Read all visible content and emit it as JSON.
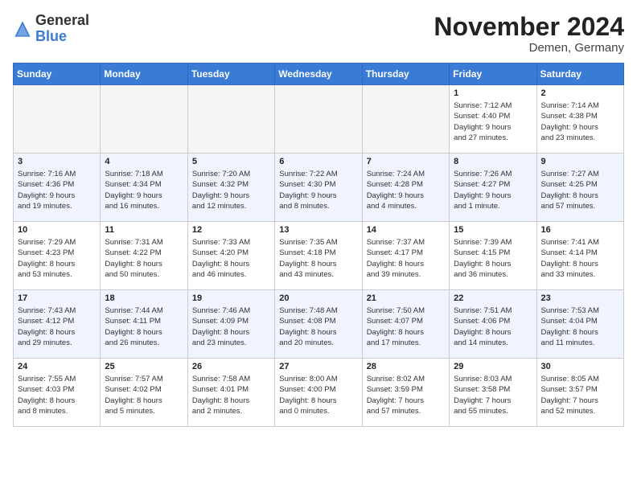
{
  "header": {
    "logo_general": "General",
    "logo_blue": "Blue",
    "month_title": "November 2024",
    "location": "Demen, Germany"
  },
  "weekdays": [
    "Sunday",
    "Monday",
    "Tuesday",
    "Wednesday",
    "Thursday",
    "Friday",
    "Saturday"
  ],
  "weeks": [
    [
      {
        "day": "",
        "info": ""
      },
      {
        "day": "",
        "info": ""
      },
      {
        "day": "",
        "info": ""
      },
      {
        "day": "",
        "info": ""
      },
      {
        "day": "",
        "info": ""
      },
      {
        "day": "1",
        "info": "Sunrise: 7:12 AM\nSunset: 4:40 PM\nDaylight: 9 hours\nand 27 minutes."
      },
      {
        "day": "2",
        "info": "Sunrise: 7:14 AM\nSunset: 4:38 PM\nDaylight: 9 hours\nand 23 minutes."
      }
    ],
    [
      {
        "day": "3",
        "info": "Sunrise: 7:16 AM\nSunset: 4:36 PM\nDaylight: 9 hours\nand 19 minutes."
      },
      {
        "day": "4",
        "info": "Sunrise: 7:18 AM\nSunset: 4:34 PM\nDaylight: 9 hours\nand 16 minutes."
      },
      {
        "day": "5",
        "info": "Sunrise: 7:20 AM\nSunset: 4:32 PM\nDaylight: 9 hours\nand 12 minutes."
      },
      {
        "day": "6",
        "info": "Sunrise: 7:22 AM\nSunset: 4:30 PM\nDaylight: 9 hours\nand 8 minutes."
      },
      {
        "day": "7",
        "info": "Sunrise: 7:24 AM\nSunset: 4:28 PM\nDaylight: 9 hours\nand 4 minutes."
      },
      {
        "day": "8",
        "info": "Sunrise: 7:26 AM\nSunset: 4:27 PM\nDaylight: 9 hours\nand 1 minute."
      },
      {
        "day": "9",
        "info": "Sunrise: 7:27 AM\nSunset: 4:25 PM\nDaylight: 8 hours\nand 57 minutes."
      }
    ],
    [
      {
        "day": "10",
        "info": "Sunrise: 7:29 AM\nSunset: 4:23 PM\nDaylight: 8 hours\nand 53 minutes."
      },
      {
        "day": "11",
        "info": "Sunrise: 7:31 AM\nSunset: 4:22 PM\nDaylight: 8 hours\nand 50 minutes."
      },
      {
        "day": "12",
        "info": "Sunrise: 7:33 AM\nSunset: 4:20 PM\nDaylight: 8 hours\nand 46 minutes."
      },
      {
        "day": "13",
        "info": "Sunrise: 7:35 AM\nSunset: 4:18 PM\nDaylight: 8 hours\nand 43 minutes."
      },
      {
        "day": "14",
        "info": "Sunrise: 7:37 AM\nSunset: 4:17 PM\nDaylight: 8 hours\nand 39 minutes."
      },
      {
        "day": "15",
        "info": "Sunrise: 7:39 AM\nSunset: 4:15 PM\nDaylight: 8 hours\nand 36 minutes."
      },
      {
        "day": "16",
        "info": "Sunrise: 7:41 AM\nSunset: 4:14 PM\nDaylight: 8 hours\nand 33 minutes."
      }
    ],
    [
      {
        "day": "17",
        "info": "Sunrise: 7:43 AM\nSunset: 4:12 PM\nDaylight: 8 hours\nand 29 minutes."
      },
      {
        "day": "18",
        "info": "Sunrise: 7:44 AM\nSunset: 4:11 PM\nDaylight: 8 hours\nand 26 minutes."
      },
      {
        "day": "19",
        "info": "Sunrise: 7:46 AM\nSunset: 4:09 PM\nDaylight: 8 hours\nand 23 minutes."
      },
      {
        "day": "20",
        "info": "Sunrise: 7:48 AM\nSunset: 4:08 PM\nDaylight: 8 hours\nand 20 minutes."
      },
      {
        "day": "21",
        "info": "Sunrise: 7:50 AM\nSunset: 4:07 PM\nDaylight: 8 hours\nand 17 minutes."
      },
      {
        "day": "22",
        "info": "Sunrise: 7:51 AM\nSunset: 4:06 PM\nDaylight: 8 hours\nand 14 minutes."
      },
      {
        "day": "23",
        "info": "Sunrise: 7:53 AM\nSunset: 4:04 PM\nDaylight: 8 hours\nand 11 minutes."
      }
    ],
    [
      {
        "day": "24",
        "info": "Sunrise: 7:55 AM\nSunset: 4:03 PM\nDaylight: 8 hours\nand 8 minutes."
      },
      {
        "day": "25",
        "info": "Sunrise: 7:57 AM\nSunset: 4:02 PM\nDaylight: 8 hours\nand 5 minutes."
      },
      {
        "day": "26",
        "info": "Sunrise: 7:58 AM\nSunset: 4:01 PM\nDaylight: 8 hours\nand 2 minutes."
      },
      {
        "day": "27",
        "info": "Sunrise: 8:00 AM\nSunset: 4:00 PM\nDaylight: 8 hours\nand 0 minutes."
      },
      {
        "day": "28",
        "info": "Sunrise: 8:02 AM\nSunset: 3:59 PM\nDaylight: 7 hours\nand 57 minutes."
      },
      {
        "day": "29",
        "info": "Sunrise: 8:03 AM\nSunset: 3:58 PM\nDaylight: 7 hours\nand 55 minutes."
      },
      {
        "day": "30",
        "info": "Sunrise: 8:05 AM\nSunset: 3:57 PM\nDaylight: 7 hours\nand 52 minutes."
      }
    ]
  ]
}
